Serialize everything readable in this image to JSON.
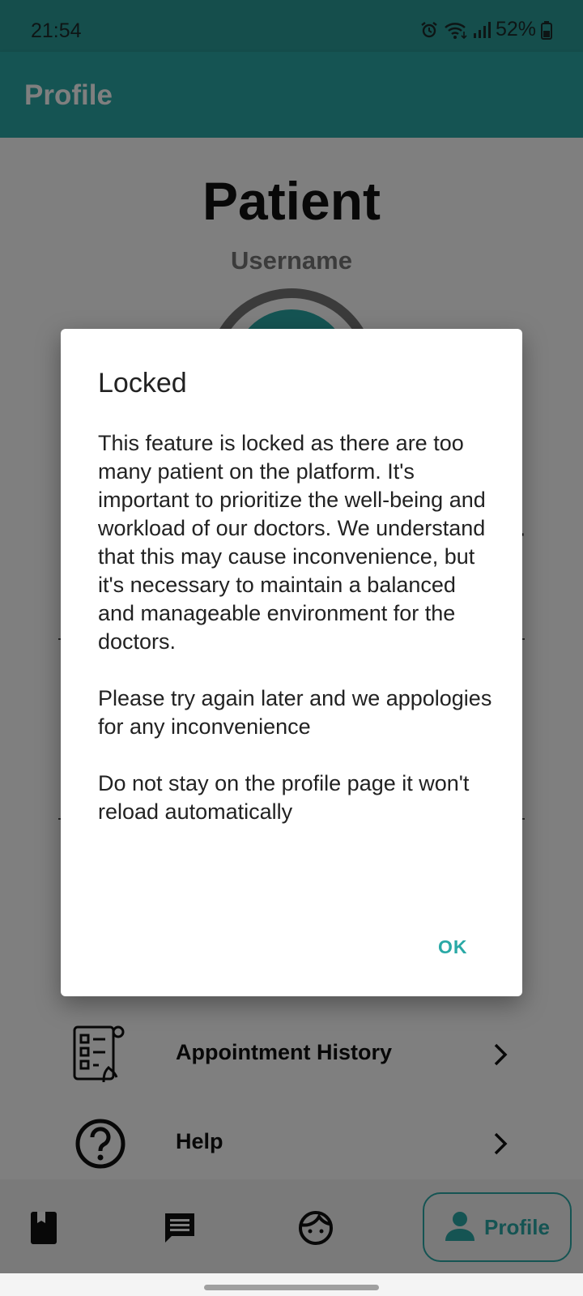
{
  "status_bar": {
    "time": "21:54",
    "battery": "52%",
    "icons": [
      "alarm-icon",
      "wifi-icon",
      "signal-icon",
      "battery-icon"
    ]
  },
  "app_bar": {
    "title": "Profile"
  },
  "profile": {
    "role": "Patient",
    "username": "Username",
    "partial_text": "r"
  },
  "menu": {
    "items": [
      {
        "label": "Appointment History",
        "icon": "appointment-history-icon"
      },
      {
        "label": "Help",
        "icon": "help-icon"
      }
    ]
  },
  "bottom_nav": {
    "items": [
      {
        "icon": "book-icon"
      },
      {
        "icon": "chat-icon"
      },
      {
        "icon": "face-icon"
      }
    ],
    "active": {
      "icon": "person-icon",
      "label": "Profile"
    }
  },
  "dialog": {
    "title": "Locked",
    "paragraphs": [
      "This feature is locked as there are too many patient on the platform. It's important to prioritize the well-being and workload of our doctors. We understand that this may cause inconvenience, but it's necessary to maintain a balanced and manageable environment for the doctors.",
      "Please try again later and we appologies for any inconvenience",
      "Do not stay on the profile page it won't reload automatically"
    ],
    "ok_label": "OK"
  },
  "colors": {
    "primary": "#2aa9a6",
    "status_bar": "#2a9d99",
    "scrim": "rgba(0,0,0,0.5)"
  }
}
